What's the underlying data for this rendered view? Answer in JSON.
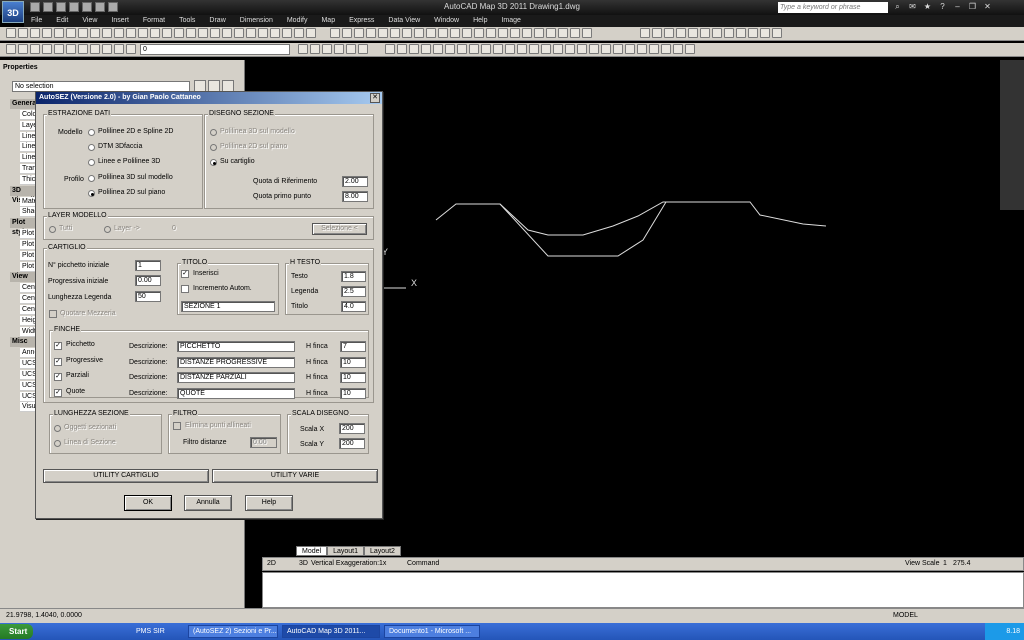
{
  "app": {
    "icon_label": "3D",
    "window_title": "AutoCAD Map 3D 2011    Drawing1.dwg",
    "search_placeholder": "Type a keyword or phrase"
  },
  "menus": [
    "File",
    "Edit",
    "View",
    "Insert",
    "Format",
    "Tools",
    "Draw",
    "Dimension",
    "Modify",
    "Map",
    "Express",
    "Data View",
    "Window",
    "Help",
    "Image"
  ],
  "toolbar": {
    "layer_value": "0"
  },
  "properties": {
    "title": "Properties",
    "selection": "No selection",
    "sections": [
      {
        "label": "General",
        "rows": [
          "Color",
          "Layer",
          "Linetype",
          "Linetype scale",
          "Lineweight",
          "Transparency",
          "Thickness"
        ]
      },
      {
        "label": "3D Visualization",
        "rows": [
          "Material",
          "Shadow display"
        ]
      },
      {
        "label": "Plot style",
        "rows": [
          "Plot style",
          "Plot style table",
          "Plot table attached",
          "Plot table type"
        ]
      },
      {
        "label": "View",
        "rows": [
          "Center X",
          "Center Y",
          "Center Z",
          "Height",
          "Width"
        ]
      },
      {
        "label": "Misc",
        "rows": [
          "Annotation scale",
          "UCS icon On",
          "UCS icon at origin",
          "UCS per viewport",
          "UCS Name",
          "Visual Style"
        ]
      }
    ]
  },
  "model_tabs": [
    "Model",
    "Layout1",
    "Layout2"
  ],
  "status": {
    "btn_2d": "2D",
    "btn_3d": "3D",
    "vert_exag_label": "Vertical Exaggeration:",
    "vert_exag_value": "1x",
    "command_label": "Command",
    "view_scale_label": "View Scale",
    "view_scale_a": "1",
    "view_scale_b": "275.4",
    "coords": "21.9798, 1.4040, 0.0000",
    "model_label": "MODEL"
  },
  "taskbar": {
    "start": "Start",
    "tray_left": "PMS SIR",
    "tasks": [
      "(AutoSEZ 2) Sezioni e Pr...",
      "AutoCAD Map 3D 2011...",
      "Documento1 - Microsoft ..."
    ],
    "clock": "8.18"
  },
  "dialog": {
    "title": "AutoSEZ (Versione 2.0) - by Gian Paolo Cattaneo",
    "estrazione": {
      "label": "ESTRAZIONE DATI",
      "modello_label": "Modello",
      "profilo_label": "Profilo",
      "options": [
        "Polilinee 2D e Spline 2D",
        "DTM 3Dfaccia",
        "Linee e Polilinee 3D",
        "Polilinea 3D sul modello",
        "Polilinea 2D sul piano"
      ]
    },
    "disegno": {
      "label": "DISEGNO SEZIONE",
      "options": [
        "Polilinea 3D sul modello",
        "Polilinea 2D sul piano",
        "Su cartiglio"
      ],
      "quota_rif_label": "Quota di Riferimento",
      "quota_rif_value": "2.00",
      "quota_primo_label": "Quota primo punto",
      "quota_primo_value": "8.00"
    },
    "layer": {
      "label": "LAYER MODELLO",
      "tutti": "Tutti",
      "layer": "Layer ->",
      "count": "0",
      "selezione": "Selezione <"
    },
    "cartiglio": {
      "label": "CARTIGLIO",
      "picchetto_label": "N° picchetto iniziale",
      "picchetto_value": "1",
      "progressiva_label": "Progressiva iniziale",
      "progressiva_value": "0.00",
      "lunghezza_label": "Lunghezza Legenda",
      "lunghezza_value": "50",
      "quotare_label": "Quotare Mezzeria"
    },
    "titolo": {
      "label": "TITOLO",
      "inserisci": "Inserisci",
      "incremento": "Incremento Autom.",
      "value": "SEZIONE 1"
    },
    "htesto": {
      "label": "H TESTO",
      "testo_label": "Testo",
      "testo_value": "1.8",
      "legenda_label": "Legenda",
      "legenda_value": "2.5",
      "titolo_label": "Titolo",
      "titolo_value": "4.0"
    },
    "finche": {
      "label": "FINCHE",
      "desc_label": "Descrizione:",
      "hfinca_label": "H finca",
      "rows": [
        {
          "name": "Picchetto",
          "desc": "PICCHETTO",
          "h": "7"
        },
        {
          "name": "Progressive",
          "desc": "DISTANZE PROGRESSIVE",
          "h": "10"
        },
        {
          "name": "Parziali",
          "desc": "DISTANZE PARZIALI",
          "h": "10"
        },
        {
          "name": "Quote",
          "desc": "QUOTE",
          "h": "10"
        }
      ]
    },
    "lunghezza": {
      "label": "LUNGHEZZA SEZIONE",
      "opt1": "Oggetti sezionati",
      "opt2": "Linea di Sezione"
    },
    "filtro": {
      "label": "FILTRO",
      "elimina": "Elimina punti allineati",
      "distanze_label": "Filtro distanze",
      "distanze_value": "0.00"
    },
    "scala": {
      "label": "SCALA DISEGNO",
      "x_label": "Scala X",
      "x_value": "200",
      "y_label": "Scala Y",
      "y_value": "200"
    },
    "utility_cartiglio": "UTILITY CARTIGLIO",
    "utility_varie": "UTILITY VARIE",
    "ok": "OK",
    "annulla": "Annulla",
    "help": "Help"
  },
  "canvas": {
    "axis_y": "Y",
    "axis_x": "X"
  }
}
